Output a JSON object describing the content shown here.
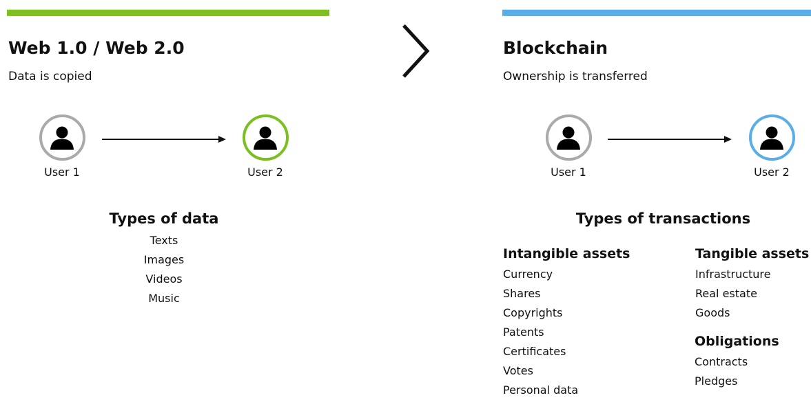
{
  "colors": {
    "web_accent": "#7cbf1f",
    "blockchain_accent": "#5aade6",
    "neutral_ring": "#aaaaaa",
    "text": "#111111"
  },
  "web": {
    "title": "Web 1.0 / Web 2.0",
    "subtitle": "Data is copied",
    "user1": "User 1",
    "user2": "User 2",
    "types_title": "Types of data",
    "types": [
      "Texts",
      "Images",
      "Videos",
      "Music"
    ]
  },
  "blockchain": {
    "title": "Blockchain",
    "subtitle": "Ownership is transferred",
    "user1": "User 1",
    "user2": "User 2",
    "types_title": "Types of transactions",
    "intangible_title": "Intangible assets",
    "intangible": [
      "Currency",
      "Shares",
      "Copyrights",
      "Patents",
      "Certificates",
      "Votes",
      "Personal data"
    ],
    "tangible_title": "Tangible assets",
    "tangible": [
      "Infrastructure",
      "Real estate",
      "Goods"
    ],
    "obligations_title": "Obligations",
    "obligations": [
      "Contracts",
      "Pledges"
    ]
  },
  "icons": {
    "avatar": "person-icon",
    "transition": "chevron-right-icon",
    "arrow": "arrow-right-icon"
  }
}
